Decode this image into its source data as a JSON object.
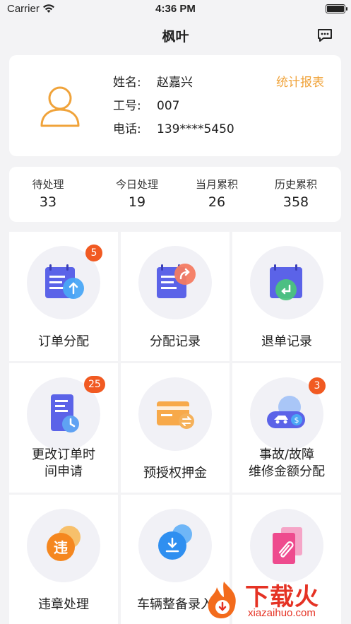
{
  "status_bar": {
    "carrier": "Carrier",
    "time": "4:36 PM"
  },
  "nav": {
    "title": "枫叶",
    "chat_icon": "chat-bubble-icon"
  },
  "profile": {
    "name_label": "姓名:",
    "name_value": "赵嘉兴",
    "id_label": "工号:",
    "id_value": "007",
    "phone_label": "电话:",
    "phone_value": "139****5450",
    "report_link": "统计报表",
    "accent_color": "#f0a33a"
  },
  "stats": [
    {
      "label": "待处理",
      "value": "33"
    },
    {
      "label": "今日处理",
      "value": "19"
    },
    {
      "label": "当月累积",
      "value": "26"
    },
    {
      "label": "历史累积",
      "value": "358"
    }
  ],
  "tiles": [
    {
      "label_lines": [
        "订单分配"
      ],
      "badge": "5",
      "icon": "order-assign-icon"
    },
    {
      "label_lines": [
        "分配记录"
      ],
      "badge": "",
      "icon": "assign-record-icon"
    },
    {
      "label_lines": [
        "退单记录"
      ],
      "badge": "",
      "icon": "return-record-icon"
    },
    {
      "label_lines": [
        "更改订单时",
        "间申请"
      ],
      "badge": "25",
      "icon": "time-change-icon"
    },
    {
      "label_lines": [
        "预授权押金"
      ],
      "badge": "",
      "icon": "deposit-card-icon"
    },
    {
      "label_lines": [
        "事故/故障",
        "维修金额分配"
      ],
      "badge": "3",
      "icon": "accident-repair-icon"
    },
    {
      "label_lines": [
        "违章处理"
      ],
      "badge": "",
      "icon": "violation-icon"
    },
    {
      "label_lines": [
        "车辆整备录入"
      ],
      "badge": "",
      "icon": "vehicle-prep-icon"
    },
    {
      "label_lines": [],
      "badge": "",
      "icon": "attachment-icon"
    }
  ],
  "watermark": {
    "title": "下载火",
    "subtitle": "xiazaihuo.com",
    "color": "#e53224"
  }
}
